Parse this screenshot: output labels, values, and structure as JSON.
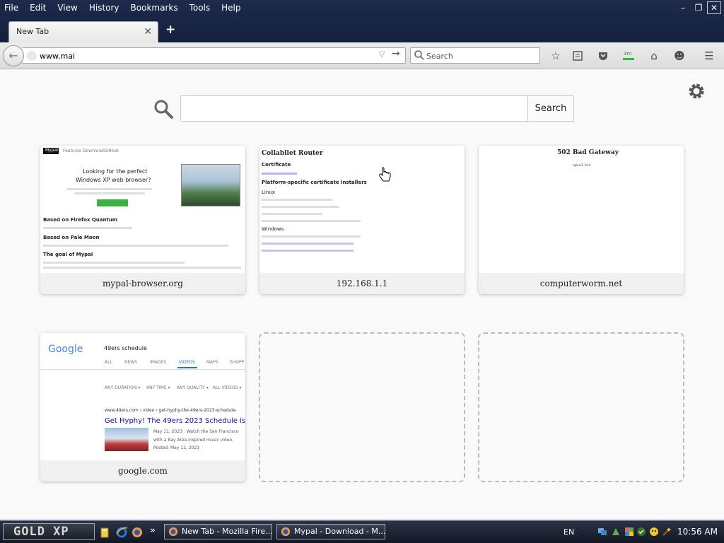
{
  "menubar": {
    "items": [
      "File",
      "Edit",
      "View",
      "History",
      "Bookmarks",
      "Tools",
      "Help"
    ]
  },
  "window_controls": {
    "minimize": "–",
    "restore": "❐",
    "close": "✕"
  },
  "tabs": [
    {
      "label": "New Tab",
      "close": "✕"
    }
  ],
  "new_tab": "+",
  "navbar": {
    "url_value": "www.mai",
    "search_placeholder": "Search"
  },
  "content": {
    "search_button": "Search",
    "tiles": [
      {
        "title": "mypal-browser.org",
        "thumb": {
          "nav": [
            "Mypal",
            "Features",
            "Download",
            "GitHub"
          ],
          "headline1": "Looking for the perfect",
          "headline2": "Windows XP web browser?",
          "h_a": "Based on Firefox Quantum",
          "h_b": "Based on Pale Moon",
          "h_c": "The goal of Mypal"
        }
      },
      {
        "title": "192.168.1.1",
        "thumb": {
          "heading": "Collabllet Router",
          "sub1": "Certificate",
          "sub2": "Platform-specific certificate installers",
          "sub3": "Linux",
          "sub4": "Windows"
        }
      },
      {
        "title": "computerworm.net",
        "thumb": {
          "heading": "502 Bad Gateway",
          "sub": "nginx/1.14.0"
        }
      },
      {
        "title": "google.com",
        "thumb": {
          "logo": "Google",
          "query": "49ers schedule",
          "tabs": [
            "ALL",
            "NEWS",
            "IMAGES",
            "VIDEOS",
            "MAPS",
            "SHOPP"
          ],
          "filters": [
            "ANY DURATION ▾",
            "ANY TIME ▾",
            "ANY QUALITY ▾",
            "ALL VIDEOS ▾"
          ],
          "breadcrumb": "www.49ers.com › video › get-hyphy-the-49ers-2023-schedule-",
          "result_title": "Get Hyphy! The 49ers 2023 Schedule is Here",
          "snippet1": "May 11, 2023 · Watch the San Francisco",
          "snippet2": "with a Bay Area inspired music video.",
          "posted": "Posted: May 11, 2023"
        }
      }
    ]
  },
  "taskbar": {
    "start_label": "GOLD XP",
    "overflow": "»",
    "tasks": [
      "New Tab - Mozilla Fire...",
      "Mypal - Download - M..."
    ],
    "language": "EN",
    "clock": "10:56 AM"
  },
  "colors": {
    "frame": "#1e2a4a",
    "link_blue": "#1a0dab",
    "accent_green": "#3cb043",
    "taskbar": "#1a1f2d"
  }
}
